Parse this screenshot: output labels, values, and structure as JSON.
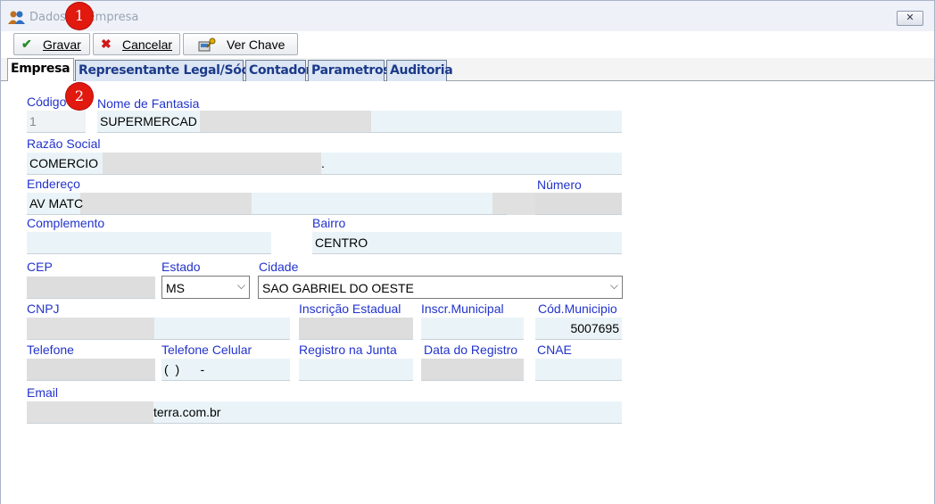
{
  "window": {
    "title": "Dados da Empresa",
    "close_label": "✕"
  },
  "badges": [
    "1",
    "2"
  ],
  "toolbar": {
    "gravar_label": "Gravar",
    "cancelar_label": "Cancelar",
    "ver_chave_label": "Ver Chave"
  },
  "tabs": [
    {
      "label": "Empresa"
    },
    {
      "label": "Representante Legal/Sócios"
    },
    {
      "label": "Contador"
    },
    {
      "label": "Parametros"
    },
    {
      "label": "Auditoria"
    }
  ],
  "form": {
    "codigo": {
      "label": "Código",
      "value": "1"
    },
    "nome_fantasia": {
      "label": "Nome de Fantasia",
      "value": "SUPERMERCAD"
    },
    "razao_social": {
      "label": "Razão Social",
      "value": "COMERCIO",
      "suffix": "."
    },
    "endereco": {
      "label": "Endereço",
      "value": "AV MATC"
    },
    "numero": {
      "label": "Número",
      "value": ""
    },
    "complemento": {
      "label": "Complemento",
      "value": ""
    },
    "bairro": {
      "label": "Bairro",
      "value": "CENTRO"
    },
    "cep": {
      "label": "CEP",
      "value": ""
    },
    "estado": {
      "label": "Estado",
      "value": "MS"
    },
    "cidade": {
      "label": "Cidade",
      "value": "SAO GABRIEL DO OESTE"
    },
    "cnpj": {
      "label": "CNPJ",
      "value": ""
    },
    "inscricao_estadual": {
      "label": "Inscrição Estadual",
      "value": ""
    },
    "inscr_municipal": {
      "label": "Inscr.Municipal",
      "value": ""
    },
    "cod_municipio": {
      "label": "Cód.Municipio",
      "value": "5007695"
    },
    "telefone": {
      "label": "Telefone",
      "value": ""
    },
    "telefone_celular": {
      "label": "Telefone Celular",
      "value": "(  )      -"
    },
    "registro_junta": {
      "label": "Registro na Junta",
      "value": ""
    },
    "data_registro": {
      "label": "Data do Registro",
      "value": ""
    },
    "cnae": {
      "label": "CNAE",
      "value": ""
    },
    "email": {
      "label": "Email",
      "value": "terra.com.br"
    }
  },
  "colors": {
    "label": "#2233cc",
    "field_bg": "#eaf4f8",
    "tab_text": "#1c3a8a",
    "badge": "#e1190f"
  },
  "icons": [
    "users-icon",
    "checkmark-icon",
    "x-cross-icon",
    "key-icon",
    "chevron-down-icon",
    "close-icon"
  ]
}
